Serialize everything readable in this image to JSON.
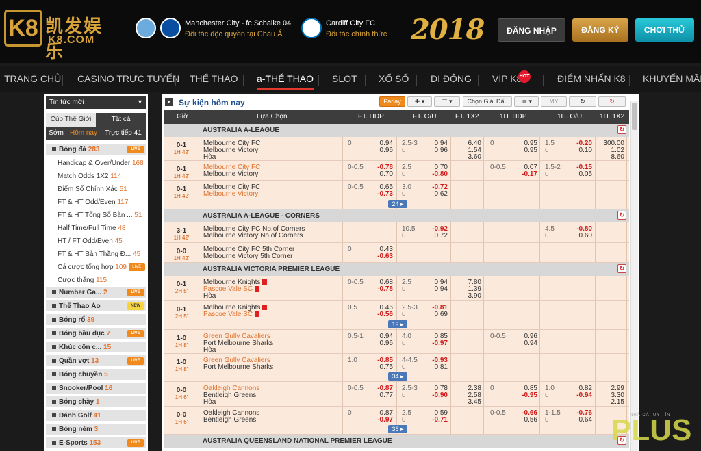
{
  "brand": {
    "logo_mark": "K8",
    "logo_cn": "凯发娱乐",
    "logo_domain": "K8.COM"
  },
  "partners": [
    {
      "title": "Manchester City - fc Schalke 04",
      "subtitle": "Đối tác độc quyền tại Châu Á"
    },
    {
      "title": "Cardiff City FC",
      "subtitle": "Đối tác chính thức"
    }
  ],
  "year_badge": "2018",
  "buttons": {
    "login": "ĐĂNG NHẬP",
    "register": "ĐĂNG KÝ",
    "try": "CHƠI THỬ"
  },
  "nav": [
    "TRANG CHỦ",
    "CASINO TRỰC TUYẾN",
    "THỂ THAO",
    "a-THỂ THAO",
    "SLOT",
    "XỔ SỐ",
    "DI ĐỘNG",
    "VIP K8",
    "ĐIỂM NHẤN K8",
    "KHUYẾN MÃI"
  ],
  "nav_hot": "HOT",
  "sidebar": {
    "news": "Tin tức mới",
    "tab_cup": "Cúp Thế Giới",
    "tab_all": "Tất cả",
    "tab_early": "Sớm",
    "tab_today": "Hôm nay",
    "tab_live": "Trực tiếp 41",
    "football": {
      "name": "Bóng đá",
      "count": "283",
      "badge": "LIVE"
    },
    "subs": [
      {
        "name": "Handicap & Over/Under",
        "count": "168"
      },
      {
        "name": "Match Odds 1X2",
        "count": "114"
      },
      {
        "name": "Điểm Số Chính Xác",
        "count": "51"
      },
      {
        "name": "FT & HT Odd/Even",
        "count": "117"
      },
      {
        "name": "FT & HT Tổng Số Bàn ...",
        "count": "51"
      },
      {
        "name": "Half Time/Full Time",
        "count": "48"
      },
      {
        "name": "HT / FT Odd/Even",
        "count": "45"
      },
      {
        "name": "FT & HT Bàn Thắng Đ...",
        "count": "45"
      },
      {
        "name": "Cá cược tổng hợp",
        "count": "109"
      },
      {
        "name": "Cược thắng",
        "count": "115"
      }
    ],
    "sports": [
      {
        "name": "Number Ga...",
        "count": "2",
        "badge": "LIVE"
      },
      {
        "name": "Thể Thao Ảo",
        "count": "",
        "badge": "NEW"
      },
      {
        "name": "Bóng rổ",
        "count": "39",
        "badge": ""
      },
      {
        "name": "Bóng bầu dục",
        "count": "7",
        "badge": "LIVE"
      },
      {
        "name": "Khúc côn c...",
        "count": "15",
        "badge": ""
      },
      {
        "name": "Quần vợt",
        "count": "13",
        "badge": "LIVE"
      },
      {
        "name": "Bóng chuyền",
        "count": "5",
        "badge": ""
      },
      {
        "name": "Snooker/Pool",
        "count": "16",
        "badge": ""
      },
      {
        "name": "Bóng chày",
        "count": "1",
        "badge": ""
      },
      {
        "name": "Đánh Golf",
        "count": "41",
        "badge": ""
      },
      {
        "name": "Bóng ném",
        "count": "3",
        "badge": ""
      },
      {
        "name": "E-Sports",
        "count": "153",
        "badge": "LIVE"
      }
    ]
  },
  "main": {
    "title": "Sự kiện hôm nay",
    "parlay": "Parlay",
    "choose_league": "Chọn Giải Đấu",
    "my": "MY",
    "columns": [
      "Giờ",
      "Lựa Chọn",
      "FT. HDP",
      "FT. O/U",
      "FT. 1X2",
      "1H. HDP",
      "1H. O/U",
      "1H. 1X2"
    ],
    "leagues": [
      "AUSTRALIA A-LEAGUE",
      "AUSTRALIA A-LEAGUE - CORNERS",
      "AUSTRALIA VICTORIA PREMIER LEAGUE",
      "AUSTRALIA QUEENSLAND NATIONAL PREMIER LEAGUE"
    ],
    "more": [
      "24",
      "19",
      "34",
      "36"
    ],
    "rows": [
      {
        "score": "0-1",
        "time": "1H 42'",
        "t1": "Melbourne City FC",
        "t2": "Melbourne Victory",
        "t3": "Hòa",
        "hl": 0,
        "fh_line": "0",
        "fh_o1": "0.94",
        "fh_o2": "0.96",
        "fo_line": "2.5-3",
        "fo_o1": "0.94",
        "fo_o2": "0.96",
        "x1": "6.40",
        "x2": "1.54",
        "x3": "3.60",
        "hh_line": "0",
        "hh_o1": "0.95",
        "hh_o2": "0.95",
        "ho_line": "1.5",
        "ho_o1": "-0.20",
        "ho_o2": "0.10",
        "h1": "300.00",
        "h2": "1.02",
        "h3": "8.60"
      },
      {
        "score": "0-1",
        "time": "1H 42'",
        "t1": "Melbourne City FC",
        "t2": "Melbourne Victory",
        "t3": "",
        "hl": 1,
        "fh_line": "0-0.5",
        "fh_o1": "-0.78",
        "fh_o2": "0.70",
        "fo_line": "2.5",
        "fo_o1": "0.70",
        "fo_o2": "-0.80",
        "x1": "",
        "x2": "",
        "x3": "",
        "hh_line": "0-0.5",
        "hh_o1": "0.07",
        "hh_o2": "-0.17",
        "ho_line": "1.5-2",
        "ho_o1": "-0.15",
        "ho_o2": "0.05",
        "h1": "",
        "h2": "",
        "h3": ""
      },
      {
        "score": "0-1",
        "time": "1H 42'",
        "t1": "Melbourne City FC",
        "t2": "Melbourne Victory",
        "t3": "",
        "hl": 2,
        "fh_line": "0-0.5",
        "fh_o1": "0.65",
        "fh_o2": "-0.73",
        "fo_line": "3.0",
        "fo_o1": "-0.72",
        "fo_o2": "0.62",
        "x1": "",
        "x2": "",
        "x3": "",
        "hh_line": "",
        "hh_o1": "",
        "hh_o2": "",
        "ho_line": "",
        "ho_o1": "",
        "ho_o2": "",
        "h1": "",
        "h2": "",
        "h3": ""
      },
      {
        "score": "3-1",
        "time": "1H 42'",
        "t1": "Melbourne City FC No.of Corners",
        "t2": "Melbourne Victory No.of Corners",
        "t3": "",
        "hl": 0,
        "fh_line": "",
        "fh_o1": "",
        "fh_o2": "",
        "fo_line": "10.5",
        "fo_o1": "-0.92",
        "fo_o2": "0.72",
        "x1": "",
        "x2": "",
        "x3": "",
        "hh_line": "",
        "hh_o1": "",
        "hh_o2": "",
        "ho_line": "4.5",
        "ho_o1": "-0.80",
        "ho_o2": "0.60",
        "h1": "",
        "h2": "",
        "h3": ""
      },
      {
        "score": "0-0",
        "time": "1H 42'",
        "t1": "Melbourne City FC 5th Corner",
        "t2": "Melbourne Victory 5th Corner",
        "t3": "",
        "hl": 0,
        "fh_line": "0",
        "fh_o1": "0.43",
        "fh_o2": "-0.63",
        "fo_line": "",
        "fo_o1": "",
        "fo_o2": "",
        "x1": "",
        "x2": "",
        "x3": "",
        "hh_line": "",
        "hh_o1": "",
        "hh_o2": "",
        "ho_line": "",
        "ho_o1": "",
        "ho_o2": "",
        "h1": "",
        "h2": "",
        "h3": ""
      },
      {
        "score": "0-1",
        "time": "2H 5'",
        "t1": "Melbourne Knights",
        "t2": "Pascoe Vale SC",
        "t3": "Hòa",
        "hl": 2,
        "fh_line": "0-0.5",
        "fh_o1": "0.68",
        "fh_o2": "-0.78",
        "fo_line": "2.5",
        "fo_o1": "0.94",
        "fo_o2": "0.94",
        "x1": "7.80",
        "x2": "1.39",
        "x3": "3.90",
        "hh_line": "",
        "hh_o1": "",
        "hh_o2": "",
        "ho_line": "",
        "ho_o1": "",
        "ho_o2": "",
        "h1": "",
        "h2": "",
        "h3": ""
      },
      {
        "score": "0-1",
        "time": "2H 5'",
        "t1": "Melbourne Knights",
        "t2": "Pascoe Vale SC",
        "t3": "",
        "hl": 2,
        "fh_line": "0.5",
        "fh_o1": "0.46",
        "fh_o2": "-0.56",
        "fo_line": "2.5-3",
        "fo_o1": "-0.81",
        "fo_o2": "0.69",
        "x1": "",
        "x2": "",
        "x3": "",
        "hh_line": "",
        "hh_o1": "",
        "hh_o2": "",
        "ho_line": "",
        "ho_o1": "",
        "ho_o2": "",
        "h1": "",
        "h2": "",
        "h3": ""
      },
      {
        "score": "1-0",
        "time": "1H 8'",
        "t1": "Green Gully Cavaliers",
        "t2": "Port Melbourne Sharks",
        "t3": "Hòa",
        "hl": 1,
        "fh_line": "0.5-1",
        "fh_o1": "0.94",
        "fh_o2": "0.96",
        "fo_line": "4.0",
        "fo_o1": "0.85",
        "fo_o2": "-0.97",
        "x1": "",
        "x2": "",
        "x3": "",
        "hh_line": "0-0.5",
        "hh_o1": "0.96",
        "hh_o2": "0.94",
        "ho_line": "",
        "ho_o1": "",
        "ho_o2": "",
        "h1": "",
        "h2": "",
        "h3": ""
      },
      {
        "score": "1-0",
        "time": "1H 8'",
        "t1": "Green Gully Cavaliers",
        "t2": "Port Melbourne Sharks",
        "t3": "",
        "hl": 1,
        "fh_line": "1.0",
        "fh_o1": "-0.85",
        "fh_o2": "0.75",
        "fo_line": "4-4.5",
        "fo_o1": "-0.93",
        "fo_o2": "0.81",
        "x1": "",
        "x2": "",
        "x3": "",
        "hh_line": "",
        "hh_o1": "",
        "hh_o2": "",
        "ho_line": "",
        "ho_o1": "",
        "ho_o2": "",
        "h1": "",
        "h2": "",
        "h3": ""
      },
      {
        "score": "0-0",
        "time": "1H 6'",
        "t1": "Oakleigh Cannons",
        "t2": "Bentleigh Greens",
        "t3": "Hòa",
        "hl": 1,
        "fh_line": "0-0.5",
        "fh_o1": "-0.87",
        "fh_o2": "0.77",
        "fo_line": "2.5-3",
        "fo_o1": "0.78",
        "fo_o2": "-0.90",
        "x1": "2.38",
        "x2": "2.58",
        "x3": "3.45",
        "hh_line": "0",
        "hh_o1": "0.85",
        "hh_o2": "-0.95",
        "ho_line": "1.0",
        "ho_o1": "0.82",
        "ho_o2": "-0.94",
        "h1": "2.99",
        "h2": "3.30",
        "h3": "2.15"
      },
      {
        "score": "0-0",
        "time": "1H 6'",
        "t1": "Oakleigh Cannons",
        "t2": "Bentleigh Greens",
        "t3": "",
        "hl": 0,
        "fh_line": "0",
        "fh_o1": "0.87",
        "fh_o2": "-0.97",
        "fo_line": "2.5",
        "fo_o1": "0.59",
        "fo_o2": "-0.71",
        "x1": "",
        "x2": "",
        "x3": "",
        "hh_line": "0-0.5",
        "hh_o1": "-0.66",
        "hh_o2": "0.56",
        "ho_line": "1-1.5",
        "ho_o1": "-0.76",
        "ho_o2": "0.64",
        "h1": "",
        "h2": "",
        "h3": ""
      }
    ]
  },
  "watermark": {
    "text": "PLUS",
    "small": "NHÀ CÁI UY TÍN"
  }
}
